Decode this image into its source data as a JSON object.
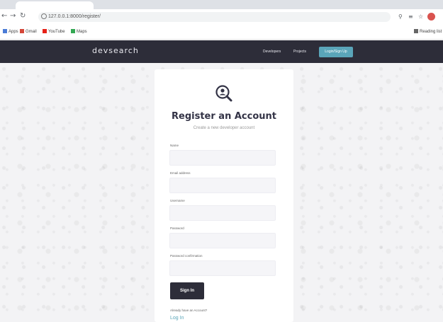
{
  "browser": {
    "address": "127.0.0.1:8000/register/",
    "bookmarks": [
      "Apps",
      "Gmail",
      "YouTube",
      "Maps"
    ],
    "reading_list": "Reading list"
  },
  "navbar": {
    "logo": "devsearch",
    "links": [
      "Developers",
      "Projects"
    ],
    "cta": "Login/Sign Up"
  },
  "form": {
    "title": "Register an Account",
    "subtitle": "Create a new developer account",
    "fields": [
      {
        "label": "Name",
        "value": ""
      },
      {
        "label": "Email address",
        "value": ""
      },
      {
        "label": "Username",
        "value": ""
      },
      {
        "label": "Password",
        "value": ""
      },
      {
        "label": "Password confirmation",
        "value": ""
      }
    ],
    "submit_label": "Sign In",
    "already_text": "Already have an Account?",
    "login_label": "Log In"
  },
  "colors": {
    "navbar": "#2d2d39",
    "accent": "#5aa5b9",
    "card": "#ffffff",
    "page_bg": "#f3f3f5"
  },
  "icons": [
    "back-arrow-icon",
    "forward-arrow-icon",
    "reload-icon",
    "info-icon",
    "zoom-icon",
    "share-icon",
    "star-icon",
    "profile-avatar-icon",
    "register-user-icon"
  ]
}
